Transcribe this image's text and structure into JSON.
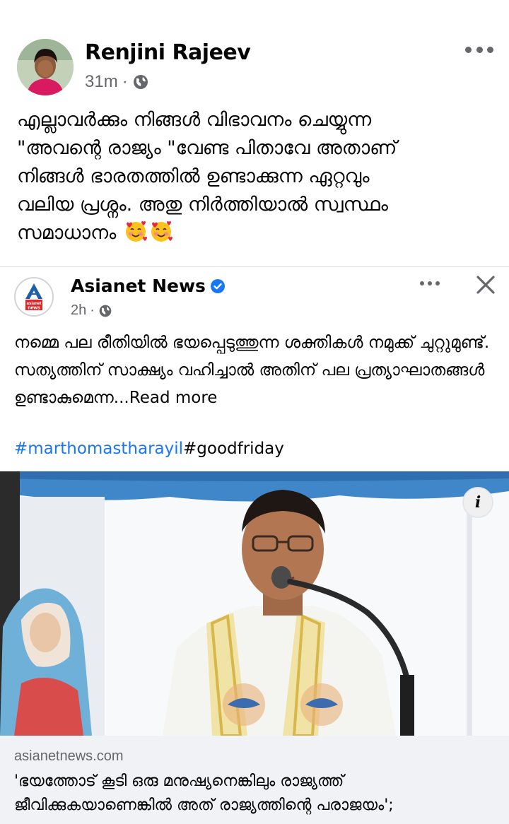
{
  "post": {
    "author": "Renjini Rajeev",
    "time": "31m",
    "separator": "·",
    "text": "എല്ലാവർക്കും  നിങ്ങൾ വിഭാവനം ചെയ്യുന്ന\n\"അവന്റെ രാജ്യം \"വേണ്ട പിതാവേ അതാണ്\nനിങ്ങൾ ഭാരതത്തിൽ ഉണ്ടാക്കുന്ന ഏറ്റവും\nവലിയ പ്രശ്നം. അതു നിർത്തിയാൽ സ്വസ്ഥം\nസമാധാനം",
    "emoji_icons": [
      "smiling-face-with-hearts-icon",
      "smiling-face-with-hearts-icon"
    ]
  },
  "shared": {
    "page_name": "Asianet News",
    "logo_text": "asianet news",
    "time": "2h",
    "separator": "·",
    "text": "നമ്മെ പല രീതിയിൽ ഭയപ്പെടുത്തുന്ന ശക്തികൾ നമുക്ക് ചുറ്റുമുണ്ട്. സത്യത്തിന് സാക്ഷ്യം വഹിച്ചാൽ അതിന് പല പ്രത്യാഘാതങ്ങൾ ഉണ്ടാകുമെന്ന...",
    "read_more": "Read more",
    "hashtag_1": "#marthomastharayil",
    "hashtag_2": "#goodfriday",
    "info_label": "i"
  },
  "link": {
    "domain": "asianetnews.com",
    "title": "'ഭയത്തോട് കൂടി ഒരു മനുഷ്യനെങ്കിലും രാജ്യത്ത് ജീവിക്കുകയാണെങ്കിൽ അത് രാജ്യത്തിന്റെ പരാജയം';"
  },
  "colors": {
    "link_blue": "#1877f2",
    "meta_gray": "#65676b",
    "preview_bg": "#f0f2f5",
    "asianet_red": "#d7262c",
    "verified_blue": "#1877f2"
  }
}
